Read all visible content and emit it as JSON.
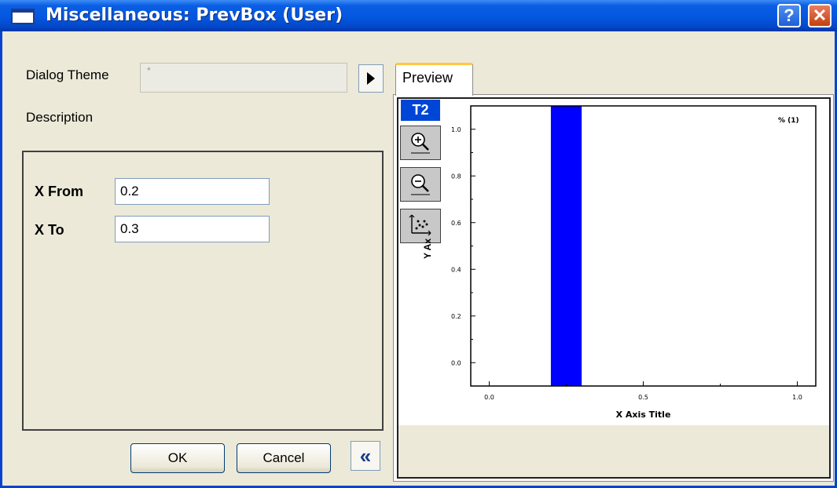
{
  "window": {
    "title": "Miscellaneous: PrevBox (User)",
    "help_label": "?",
    "close_label": "✕"
  },
  "theme": {
    "label": "Dialog Theme",
    "value": "*"
  },
  "description_label": "Description",
  "fields": {
    "x_from_label": "X From",
    "x_from_value": "0.2",
    "x_to_label": "X To",
    "x_to_value": "0.3"
  },
  "buttons": {
    "ok": "OK",
    "cancel": "Cancel",
    "collapse": "«"
  },
  "preview": {
    "tab_label": "Preview",
    "layer_label": "T2"
  },
  "chart_data": {
    "type": "bar",
    "x_bar": [
      0.2,
      0.3
    ],
    "values": [
      1.1
    ],
    "xlim": [
      -0.06,
      1.06
    ],
    "ylim": [
      -0.1,
      1.1
    ],
    "xticks": [
      "0.0",
      "0.5",
      "1.0"
    ],
    "yticks": [
      "0.0",
      "0.2",
      "0.4",
      "0.6",
      "0.8",
      "1.0"
    ],
    "xlabel": "X Axis Title",
    "ylabel": "Y Ax",
    "legend": "% (1)",
    "color": "#0000ff"
  }
}
